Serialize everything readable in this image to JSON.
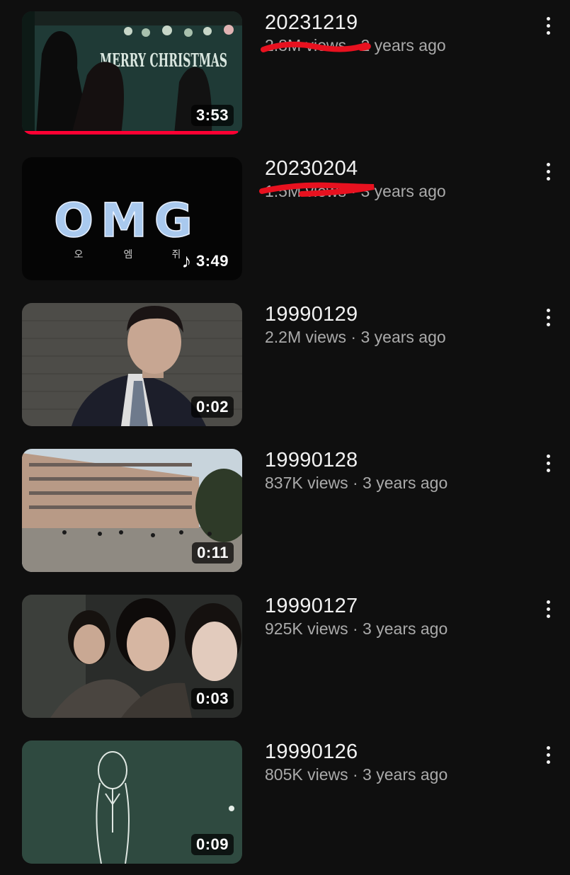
{
  "videos": [
    {
      "title": "20231219",
      "meta": "2.8M views · 2 years ago",
      "duration": "3:53",
      "music": "",
      "progress": 0.98,
      "menu_icon": "more-vert-icon"
    },
    {
      "title": "20230204",
      "meta": "1.5M views · 3 years ago",
      "duration": "3:49",
      "music": "♪",
      "progress": 0,
      "menu_icon": "more-vert-icon"
    },
    {
      "title": "19990129",
      "meta": "2.2M views · 3 years ago",
      "duration": "0:02",
      "music": "",
      "progress": 0,
      "menu_icon": "more-vert-icon"
    },
    {
      "title": "19990128",
      "meta": "837K views · 3 years ago",
      "duration": "0:11",
      "music": "",
      "progress": 0,
      "menu_icon": "more-vert-icon"
    },
    {
      "title": "19990127",
      "meta": "925K views · 3 years ago",
      "duration": "0:03",
      "music": "",
      "progress": 0,
      "menu_icon": "more-vert-icon"
    },
    {
      "title": "19990126",
      "meta": "805K views · 3 years ago",
      "duration": "0:09",
      "music": "",
      "progress": 0,
      "menu_icon": "more-vert-icon"
    }
  ],
  "thumbnail_text": {
    "v1_board": "MERRY CHRISTMAS",
    "v2_logo": "OMG",
    "v2_hangul": [
      "오",
      "엠",
      "쥐"
    ]
  },
  "colors": {
    "background": "#0f0f0f",
    "title": "#f1f1f1",
    "meta": "#aaaaaa",
    "progress": "#ff0033",
    "redaction": "#e8111f"
  }
}
